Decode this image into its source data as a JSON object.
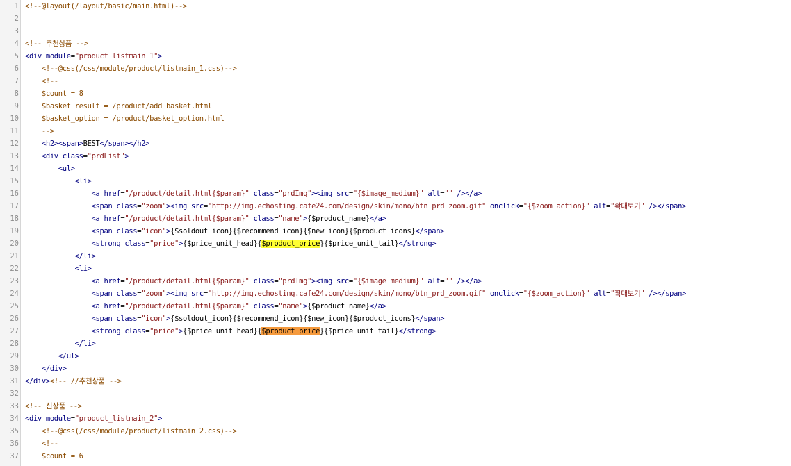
{
  "editor": {
    "lines": [
      {
        "n": "1",
        "tokens": [
          {
            "t": "<!--@layout(/layout/basic/main.html)-->",
            "c": "comment"
          }
        ]
      },
      {
        "n": "2",
        "tokens": []
      },
      {
        "n": "3",
        "tokens": []
      },
      {
        "n": "4",
        "tokens": [
          {
            "t": "<!-- 추천상품 -->",
            "c": "comment"
          }
        ]
      },
      {
        "n": "5",
        "tokens": [
          {
            "t": "<div ",
            "c": "tag"
          },
          {
            "t": "module",
            "c": "attr"
          },
          {
            "t": "=",
            "c": "text"
          },
          {
            "t": "\"product_listmain_1\"",
            "c": "string"
          },
          {
            "t": ">",
            "c": "tag"
          }
        ]
      },
      {
        "n": "6",
        "tokens": [
          {
            "t": "    ",
            "c": "text"
          },
          {
            "t": "<!--@css(/css/module/product/listmain_1.css)-->",
            "c": "comment"
          }
        ]
      },
      {
        "n": "7",
        "tokens": [
          {
            "t": "    ",
            "c": "text"
          },
          {
            "t": "<!--",
            "c": "comment"
          }
        ]
      },
      {
        "n": "8",
        "tokens": [
          {
            "t": "    ",
            "c": "text"
          },
          {
            "t": "$count = 8",
            "c": "comment"
          }
        ]
      },
      {
        "n": "9",
        "tokens": [
          {
            "t": "    ",
            "c": "text"
          },
          {
            "t": "$basket_result = /product/add_basket.html",
            "c": "comment"
          }
        ]
      },
      {
        "n": "10",
        "tokens": [
          {
            "t": "    ",
            "c": "text"
          },
          {
            "t": "$basket_option = /product/basket_option.html",
            "c": "comment"
          }
        ]
      },
      {
        "n": "11",
        "tokens": [
          {
            "t": "    ",
            "c": "text"
          },
          {
            "t": "-->",
            "c": "comment"
          }
        ]
      },
      {
        "n": "12",
        "tokens": [
          {
            "t": "    ",
            "c": "text"
          },
          {
            "t": "<h2><span>",
            "c": "tag"
          },
          {
            "t": "BEST",
            "c": "text"
          },
          {
            "t": "</span></h2>",
            "c": "tag"
          }
        ]
      },
      {
        "n": "13",
        "tokens": [
          {
            "t": "    ",
            "c": "text"
          },
          {
            "t": "<div ",
            "c": "tag"
          },
          {
            "t": "class",
            "c": "attr"
          },
          {
            "t": "=",
            "c": "text"
          },
          {
            "t": "\"prdList\"",
            "c": "string"
          },
          {
            "t": ">",
            "c": "tag"
          }
        ]
      },
      {
        "n": "14",
        "tokens": [
          {
            "t": "        ",
            "c": "text"
          },
          {
            "t": "<ul>",
            "c": "tag"
          }
        ]
      },
      {
        "n": "15",
        "tokens": [
          {
            "t": "            ",
            "c": "text"
          },
          {
            "t": "<li>",
            "c": "tag"
          }
        ]
      },
      {
        "n": "16",
        "tokens": [
          {
            "t": "                ",
            "c": "text"
          },
          {
            "t": "<a ",
            "c": "tag"
          },
          {
            "t": "href",
            "c": "attr"
          },
          {
            "t": "=",
            "c": "text"
          },
          {
            "t": "\"/product/detail.html{$param}\"",
            "c": "string"
          },
          {
            "t": " class",
            "c": "attr"
          },
          {
            "t": "=",
            "c": "text"
          },
          {
            "t": "\"prdImg\"",
            "c": "string"
          },
          {
            "t": "><img ",
            "c": "tag"
          },
          {
            "t": "src",
            "c": "attr"
          },
          {
            "t": "=",
            "c": "text"
          },
          {
            "t": "\"{$image_medium}\"",
            "c": "string"
          },
          {
            "t": " alt",
            "c": "attr"
          },
          {
            "t": "=",
            "c": "text"
          },
          {
            "t": "\"\"",
            "c": "string"
          },
          {
            "t": " /></a>",
            "c": "tag"
          }
        ]
      },
      {
        "n": "17",
        "tokens": [
          {
            "t": "                ",
            "c": "text"
          },
          {
            "t": "<span ",
            "c": "tag"
          },
          {
            "t": "class",
            "c": "attr"
          },
          {
            "t": "=",
            "c": "text"
          },
          {
            "t": "\"zoom\"",
            "c": "string"
          },
          {
            "t": "><img ",
            "c": "tag"
          },
          {
            "t": "src",
            "c": "attr"
          },
          {
            "t": "=",
            "c": "text"
          },
          {
            "t": "\"http://img.echosting.cafe24.com/design/skin/mono/btn_prd_zoom.gif\"",
            "c": "string"
          },
          {
            "t": " onclick",
            "c": "attr"
          },
          {
            "t": "=",
            "c": "text"
          },
          {
            "t": "\"{$zoom_action}\"",
            "c": "string"
          },
          {
            "t": " alt",
            "c": "attr"
          },
          {
            "t": "=",
            "c": "text"
          },
          {
            "t": "\"확대보기\"",
            "c": "string"
          },
          {
            "t": " /></span>",
            "c": "tag"
          }
        ]
      },
      {
        "n": "18",
        "tokens": [
          {
            "t": "                ",
            "c": "text"
          },
          {
            "t": "<a ",
            "c": "tag"
          },
          {
            "t": "href",
            "c": "attr"
          },
          {
            "t": "=",
            "c": "text"
          },
          {
            "t": "\"/product/detail.html{$param}\"",
            "c": "string"
          },
          {
            "t": " class",
            "c": "attr"
          },
          {
            "t": "=",
            "c": "text"
          },
          {
            "t": "\"name\"",
            "c": "string"
          },
          {
            "t": ">",
            "c": "tag"
          },
          {
            "t": "{$product_name}",
            "c": "text"
          },
          {
            "t": "</a>",
            "c": "tag"
          }
        ]
      },
      {
        "n": "19",
        "tokens": [
          {
            "t": "                ",
            "c": "text"
          },
          {
            "t": "<span ",
            "c": "tag"
          },
          {
            "t": "class",
            "c": "attr"
          },
          {
            "t": "=",
            "c": "text"
          },
          {
            "t": "\"icon\"",
            "c": "string"
          },
          {
            "t": ">",
            "c": "tag"
          },
          {
            "t": "{$soldout_icon}{$recommend_icon}{$new_icon}{$product_icons}",
            "c": "text"
          },
          {
            "t": "</span>",
            "c": "tag"
          }
        ]
      },
      {
        "n": "20",
        "tokens": [
          {
            "t": "                ",
            "c": "text"
          },
          {
            "t": "<strong ",
            "c": "tag"
          },
          {
            "t": "class",
            "c": "attr"
          },
          {
            "t": "=",
            "c": "text"
          },
          {
            "t": "\"price\"",
            "c": "string"
          },
          {
            "t": ">",
            "c": "tag"
          },
          {
            "t": "{$price_unit_head}{",
            "c": "text"
          },
          {
            "t": "$product_price",
            "c": "text",
            "hl": "yellow"
          },
          {
            "t": "}{$price_unit_tail}",
            "c": "text"
          },
          {
            "t": "</strong>",
            "c": "tag"
          }
        ]
      },
      {
        "n": "21",
        "tokens": [
          {
            "t": "            ",
            "c": "text"
          },
          {
            "t": "</li>",
            "c": "tag"
          }
        ]
      },
      {
        "n": "22",
        "tokens": [
          {
            "t": "            ",
            "c": "text"
          },
          {
            "t": "<li>",
            "c": "tag"
          }
        ]
      },
      {
        "n": "23",
        "tokens": [
          {
            "t": "                ",
            "c": "text"
          },
          {
            "t": "<a ",
            "c": "tag"
          },
          {
            "t": "href",
            "c": "attr"
          },
          {
            "t": "=",
            "c": "text"
          },
          {
            "t": "\"/product/detail.html{$param}\"",
            "c": "string"
          },
          {
            "t": " class",
            "c": "attr"
          },
          {
            "t": "=",
            "c": "text"
          },
          {
            "t": "\"prdImg\"",
            "c": "string"
          },
          {
            "t": "><img ",
            "c": "tag"
          },
          {
            "t": "src",
            "c": "attr"
          },
          {
            "t": "=",
            "c": "text"
          },
          {
            "t": "\"{$image_medium}\"",
            "c": "string"
          },
          {
            "t": " alt",
            "c": "attr"
          },
          {
            "t": "=",
            "c": "text"
          },
          {
            "t": "\"\"",
            "c": "string"
          },
          {
            "t": " /></a>",
            "c": "tag"
          }
        ]
      },
      {
        "n": "24",
        "tokens": [
          {
            "t": "                ",
            "c": "text"
          },
          {
            "t": "<span ",
            "c": "tag"
          },
          {
            "t": "class",
            "c": "attr"
          },
          {
            "t": "=",
            "c": "text"
          },
          {
            "t": "\"zoom\"",
            "c": "string"
          },
          {
            "t": "><img ",
            "c": "tag"
          },
          {
            "t": "src",
            "c": "attr"
          },
          {
            "t": "=",
            "c": "text"
          },
          {
            "t": "\"http://img.echosting.cafe24.com/design/skin/mono/btn_prd_zoom.gif\"",
            "c": "string"
          },
          {
            "t": " onclick",
            "c": "attr"
          },
          {
            "t": "=",
            "c": "text"
          },
          {
            "t": "\"{$zoom_action}\"",
            "c": "string"
          },
          {
            "t": " alt",
            "c": "attr"
          },
          {
            "t": "=",
            "c": "text"
          },
          {
            "t": "\"확대보기\"",
            "c": "string"
          },
          {
            "t": " /></span>",
            "c": "tag"
          }
        ]
      },
      {
        "n": "25",
        "tokens": [
          {
            "t": "                ",
            "c": "text"
          },
          {
            "t": "<a ",
            "c": "tag"
          },
          {
            "t": "href",
            "c": "attr"
          },
          {
            "t": "=",
            "c": "text"
          },
          {
            "t": "\"/product/detail.html{$param}\"",
            "c": "string"
          },
          {
            "t": " class",
            "c": "attr"
          },
          {
            "t": "=",
            "c": "text"
          },
          {
            "t": "\"name\"",
            "c": "string"
          },
          {
            "t": ">",
            "c": "tag"
          },
          {
            "t": "{$product_name}",
            "c": "text"
          },
          {
            "t": "</a>",
            "c": "tag"
          }
        ]
      },
      {
        "n": "26",
        "tokens": [
          {
            "t": "                ",
            "c": "text"
          },
          {
            "t": "<span ",
            "c": "tag"
          },
          {
            "t": "class",
            "c": "attr"
          },
          {
            "t": "=",
            "c": "text"
          },
          {
            "t": "\"icon\"",
            "c": "string"
          },
          {
            "t": ">",
            "c": "tag"
          },
          {
            "t": "{$soldout_icon}{$recommend_icon}{$new_icon}{$product_icons}",
            "c": "text"
          },
          {
            "t": "</span>",
            "c": "tag"
          }
        ]
      },
      {
        "n": "27",
        "tokens": [
          {
            "t": "                ",
            "c": "text"
          },
          {
            "t": "<strong ",
            "c": "tag"
          },
          {
            "t": "class",
            "c": "attr"
          },
          {
            "t": "=",
            "c": "text"
          },
          {
            "t": "\"price\"",
            "c": "string"
          },
          {
            "t": ">",
            "c": "tag"
          },
          {
            "t": "{$price_unit_head}{",
            "c": "text"
          },
          {
            "t": "$product_price",
            "c": "text",
            "hl": "orange"
          },
          {
            "t": "}{$price_unit_tail}",
            "c": "text"
          },
          {
            "t": "</strong>",
            "c": "tag"
          }
        ]
      },
      {
        "n": "28",
        "tokens": [
          {
            "t": "            ",
            "c": "text"
          },
          {
            "t": "</li>",
            "c": "tag"
          }
        ]
      },
      {
        "n": "29",
        "tokens": [
          {
            "t": "        ",
            "c": "text"
          },
          {
            "t": "</ul>",
            "c": "tag"
          }
        ]
      },
      {
        "n": "30",
        "tokens": [
          {
            "t": "    ",
            "c": "text"
          },
          {
            "t": "</div>",
            "c": "tag"
          }
        ]
      },
      {
        "n": "31",
        "tokens": [
          {
            "t": "</div>",
            "c": "tag"
          },
          {
            "t": "<!-- //추천상품 -->",
            "c": "comment"
          }
        ]
      },
      {
        "n": "32",
        "tokens": []
      },
      {
        "n": "33",
        "tokens": [
          {
            "t": "<!-- 신상품 -->",
            "c": "comment"
          }
        ]
      },
      {
        "n": "34",
        "tokens": [
          {
            "t": "<div ",
            "c": "tag"
          },
          {
            "t": "module",
            "c": "attr"
          },
          {
            "t": "=",
            "c": "text"
          },
          {
            "t": "\"product_listmain_2\"",
            "c": "string"
          },
          {
            "t": ">",
            "c": "tag"
          }
        ]
      },
      {
        "n": "35",
        "tokens": [
          {
            "t": "    ",
            "c": "text"
          },
          {
            "t": "<!--@css(/css/module/product/listmain_2.css)-->",
            "c": "comment"
          }
        ]
      },
      {
        "n": "36",
        "tokens": [
          {
            "t": "    ",
            "c": "text"
          },
          {
            "t": "<!--",
            "c": "comment"
          }
        ]
      },
      {
        "n": "37",
        "tokens": [
          {
            "t": "    ",
            "c": "text"
          },
          {
            "t": "$count = 6",
            "c": "comment"
          }
        ]
      }
    ]
  },
  "colors": {
    "comment": "#8a4a00",
    "tag": "#000080",
    "attr": "#000080",
    "string": "#8a1a1a",
    "text": "#000000",
    "highlight_yellow": "#ffff33",
    "highlight_orange": "#f59a3d"
  }
}
